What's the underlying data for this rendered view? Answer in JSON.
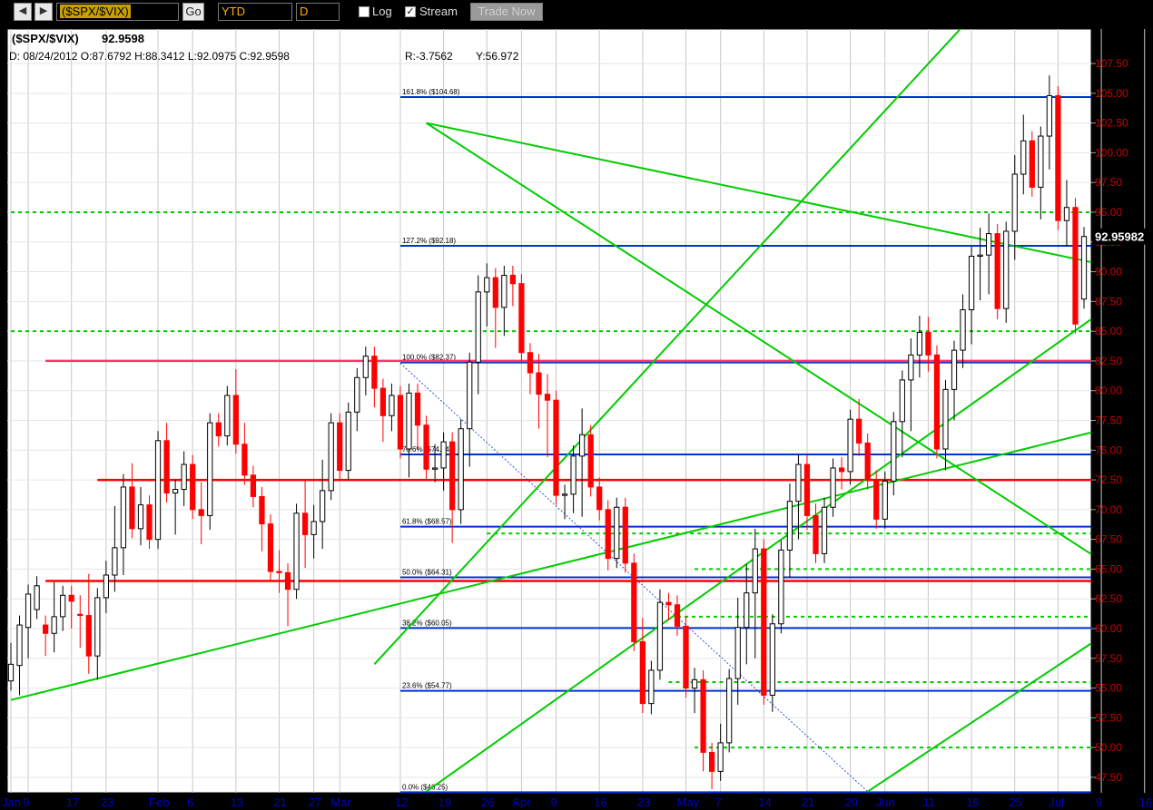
{
  "toolbar": {
    "back_icon": "chevron-left-icon",
    "forward_icon": "chevron-right-icon",
    "symbol_value": "($SPX/$VIX)",
    "go_label": "Go",
    "range_value": "YTD",
    "period_value": "D",
    "log_label": "Log",
    "log_checked": false,
    "stream_label": "Stream",
    "stream_checked": true,
    "trade_label": "Trade Now"
  },
  "header": {
    "title": "($SPX/$VIX)",
    "last": "92.9598",
    "ohlc": "D: 08/24/2012 O:87.6792 H:88.3412 L:92.0975 C:92.9598",
    "range_text": "R:-3.7562",
    "y_text": "Y:56.972"
  },
  "colors": {
    "background": "#ffffff",
    "frame": "#000000",
    "up_candle": "#000000",
    "down_candle": "#ff0000",
    "fib_line": "#0033cc",
    "trend_line": "#00cc00",
    "horizontal_red": "#ff0000",
    "horizontal_pink": "#ff3366",
    "cyan_line": "#00bbee",
    "axis_text": "#cc0000",
    "date_text": "#0000cc"
  },
  "chart_data": {
    "type": "candlestick",
    "title": "($SPX/$VIX)",
    "ylim": [
      46.2,
      110.4
    ],
    "y_ticks": [
      47.5,
      50,
      52.5,
      55,
      57.5,
      60,
      62.5,
      65,
      67.5,
      70,
      72.5,
      75,
      77.5,
      80,
      82.5,
      85,
      87.5,
      90,
      92.5,
      95,
      97.5,
      100,
      102.5,
      105,
      107.5
    ],
    "last_value_label": "92.95982",
    "x_labels": [
      {
        "label": "Jan",
        "i": 0
      },
      {
        "label": "9",
        "i": 2
      },
      {
        "label": "17",
        "i": 7
      },
      {
        "label": "23",
        "i": 11
      },
      {
        "label": "Feb",
        "i": 17
      },
      {
        "label": "6",
        "i": 21
      },
      {
        "label": "13",
        "i": 26
      },
      {
        "label": "21",
        "i": 31
      },
      {
        "label": "27",
        "i": 35
      },
      {
        "label": "Mar",
        "i": 38
      },
      {
        "label": "12",
        "i": 45
      },
      {
        "label": "19",
        "i": 50
      },
      {
        "label": "26",
        "i": 55
      },
      {
        "label": "Apr",
        "i": 59
      },
      {
        "label": "9",
        "i": 63
      },
      {
        "label": "16",
        "i": 68
      },
      {
        "label": "23",
        "i": 73
      },
      {
        "label": "May",
        "i": 78
      },
      {
        "label": "7",
        "i": 82
      },
      {
        "label": "14",
        "i": 87
      },
      {
        "label": "21",
        "i": 92
      },
      {
        "label": "29",
        "i": 97
      },
      {
        "label": "Jun",
        "i": 101
      },
      {
        "label": "11",
        "i": 106
      },
      {
        "label": "18",
        "i": 111
      },
      {
        "label": "25",
        "i": 116
      },
      {
        "label": "Jul",
        "i": 121
      },
      {
        "label": "9",
        "i": 126
      },
      {
        "label": "16",
        "i": 131
      },
      {
        "label": "23",
        "i": 136
      },
      {
        "label": "Aug",
        "i": 142
      },
      {
        "label": "6",
        "i": 146
      },
      {
        "label": "13",
        "i": 151
      },
      {
        "label": "20",
        "i": 156
      }
    ],
    "candles": [
      [
        55.6,
        58.0,
        55.6,
        57.0
      ],
      [
        56.9,
        59.1,
        55.2,
        60.3
      ],
      [
        60.1,
        62.9,
        58.3,
        62.9
      ],
      [
        61.6,
        63.6,
        61.6,
        63.6
      ],
      [
        60.3,
        60.3,
        58.5,
        59.6
      ],
      [
        59.6,
        63.1,
        58.8,
        61.0
      ],
      [
        61.0,
        62.5,
        60.6,
        62.8
      ],
      [
        62.8,
        62.6,
        60.8,
        62.3
      ],
      [
        61.2,
        62.0,
        59.2,
        61.1
      ],
      [
        61.1,
        63.8,
        57.0,
        57.7
      ],
      [
        57.7,
        62.2,
        56.5,
        62.6
      ],
      [
        62.6,
        64.9,
        62.1,
        64.5
      ],
      [
        64.5,
        69.5,
        63.9,
        66.8
      ],
      [
        66.8,
        72.2,
        65.3,
        71.9
      ],
      [
        71.9,
        73.1,
        70.0,
        68.4
      ],
      [
        68.4,
        71.1,
        67.8,
        70.4
      ],
      [
        70.4,
        68.1,
        67.7,
        67.5
      ],
      [
        67.5,
        73.6,
        67.6,
        75.8
      ],
      [
        75.8,
        76.5,
        73.6,
        71.4
      ],
      [
        71.4,
        69.1,
        68.7,
        71.7
      ],
      [
        71.7,
        74.1,
        71.1,
        73.8
      ],
      [
        73.8,
        71.1,
        70.6,
        70.0
      ],
      [
        70.0,
        71.5,
        67.9,
        69.5
      ],
      [
        69.5,
        77.1,
        69.1,
        77.3
      ],
      [
        77.3,
        77.2,
        76.1,
        76.2
      ],
      [
        76.2,
        77.8,
        76.4,
        79.6
      ],
      [
        79.6,
        81.0,
        75.8,
        75.5
      ],
      [
        75.5,
        76.5,
        73.7,
        72.9
      ],
      [
        72.9,
        71.4,
        71.0,
        71.1
      ],
      [
        71.1,
        69.7,
        67.3,
        68.8
      ],
      [
        68.8,
        67.8,
        65.2,
        64.8
      ],
      [
        64.8,
        65.8,
        63.8,
        64.7
      ],
      [
        64.7,
        63.4,
        61.0,
        63.3
      ],
      [
        63.3,
        67.8,
        63.4,
        69.7
      ],
      [
        69.7,
        71.7,
        65.9,
        67.9
      ],
      [
        67.9,
        69.6,
        66.7,
        69.0
      ],
      [
        69.0,
        73.4,
        67.5,
        71.6
      ],
      [
        71.6,
        75.1,
        72.0,
        77.3
      ],
      [
        77.3,
        74.4,
        73.8,
        73.3
      ],
      [
        73.3,
        77.3,
        73.9,
        78.2
      ],
      [
        78.2,
        79.9,
        77.4,
        81.1
      ],
      [
        81.1,
        82.4,
        80.4,
        82.9
      ],
      [
        82.9,
        81.5,
        79.4,
        80.2
      ],
      [
        80.2,
        78.5,
        76.5,
        77.9
      ],
      [
        77.9,
        79.8,
        77.4,
        79.6
      ],
      [
        79.6,
        77.0,
        76.1,
        75.1
      ],
      [
        75.1,
        78.3,
        73.5,
        79.8
      ],
      [
        79.8,
        76.9,
        75.9,
        77.1
      ],
      [
        77.1,
        73.6,
        73.2,
        73.4
      ],
      [
        73.4,
        74.7,
        73.1,
        73.5
      ],
      [
        73.5,
        74.1,
        72.4,
        75.7
      ],
      [
        75.7,
        70.8,
        68.0,
        70.0
      ],
      [
        70.0,
        75.4,
        69.6,
        76.8
      ],
      [
        76.8,
        79.5,
        74.4,
        82.4
      ],
      [
        82.4,
        88.9,
        80.5,
        88.3
      ],
      [
        88.3,
        89.9,
        86.2,
        89.5
      ],
      [
        89.5,
        87.6,
        84.4,
        87.0
      ],
      [
        87.0,
        88.3,
        85.4,
        89.7
      ],
      [
        89.7,
        89.3,
        87.9,
        89.0
      ],
      [
        89.0,
        88.3,
        84.6,
        83.2
      ],
      [
        83.2,
        81.7,
        80.5,
        81.5
      ],
      [
        81.5,
        82.3,
        77.6,
        79.7
      ],
      [
        79.7,
        80.6,
        75.2,
        79.2
      ],
      [
        79.2,
        75.1,
        72.1,
        71.2
      ],
      [
        71.2,
        71.2,
        70.0,
        71.3
      ],
      [
        71.3,
        74.6,
        70.5,
        74.5
      ],
      [
        74.5,
        77.7,
        70.2,
        76.3
      ],
      [
        76.3,
        76.1,
        72.7,
        71.9
      ],
      [
        71.9,
        70.7,
        69.9,
        70.0
      ],
      [
        70.0,
        67.6,
        65.7,
        65.9
      ],
      [
        65.9,
        68.2,
        67.1,
        70.2
      ],
      [
        70.2,
        67.5,
        66.4,
        65.5
      ],
      [
        65.5,
        61.5,
        59.1,
        58.9
      ],
      [
        58.9,
        60.1,
        53.7,
        53.7
      ],
      [
        53.7,
        56.0,
        53.6,
        56.5
      ],
      [
        56.5,
        62.5,
        58.0,
        62.2
      ],
      [
        62.2,
        61.9,
        61.5,
        62.0
      ],
      [
        62.0,
        61.0,
        60.2,
        60.2
      ],
      [
        60.2,
        55.9,
        55.4,
        55.0
      ],
      [
        55.0,
        55.9,
        53.7,
        55.7
      ],
      [
        55.7,
        52.4,
        48.8,
        49.6
      ],
      [
        49.6,
        49.2,
        47.3,
        48.0
      ],
      [
        48.0,
        51.2,
        48.4,
        50.4
      ],
      [
        50.4,
        53.3,
        51.4,
        55.8
      ],
      [
        55.8,
        61.8,
        54.4,
        60.1
      ],
      [
        60.1,
        64.6,
        57.8,
        63.0
      ],
      [
        63.0,
        67.6,
        58.3,
        66.7
      ],
      [
        66.7,
        57.8,
        55.5,
        54.4
      ],
      [
        54.4,
        60.3,
        53.8,
        60.4
      ],
      [
        60.4,
        66.4,
        61.3,
        66.6
      ],
      [
        66.6,
        71.4,
        65.1,
        70.7
      ],
      [
        70.7,
        73.1,
        68.3,
        73.8
      ],
      [
        73.8,
        71.5,
        69.1,
        69.5
      ],
      [
        69.5,
        69.7,
        67.4,
        66.3
      ],
      [
        66.3,
        68.9,
        67.6,
        70.2
      ],
      [
        70.2,
        72.5,
        71.4,
        73.5
      ],
      [
        73.5,
        73.6,
        72.5,
        73.2
      ],
      [
        73.2,
        76.2,
        72.9,
        77.6
      ],
      [
        77.6,
        78.5,
        75.3,
        75.6
      ],
      [
        75.6,
        73.9,
        73.3,
        72.5
      ],
      [
        72.5,
        69.7,
        69.5,
        69.2
      ],
      [
        69.2,
        71.5,
        69.8,
        72.4
      ],
      [
        72.4,
        75.3,
        72.0,
        77.4
      ],
      [
        77.4,
        80.3,
        75.2,
        80.9
      ],
      [
        80.9,
        83.6,
        77.4,
        83.0
      ],
      [
        83.0,
        85.5,
        81.9,
        84.9
      ],
      [
        84.9,
        85.4,
        82.4,
        83.0
      ],
      [
        83.0,
        80.8,
        76.1,
        75.1
      ],
      [
        75.1,
        79.4,
        74.1,
        80.1
      ],
      [
        80.1,
        82.9,
        78.3,
        83.4
      ],
      [
        83.4,
        87.3,
        82.7,
        86.8
      ],
      [
        86.8,
        91.2,
        84.7,
        91.3
      ],
      [
        91.3,
        92.9,
        88.4,
        91.4
      ],
      [
        91.4,
        94.1,
        88.9,
        93.2
      ],
      [
        93.2,
        89.2,
        86.8,
        86.9
      ],
      [
        86.9,
        93.4,
        86.5,
        93.4
      ],
      [
        93.4,
        99.0,
        91.8,
        98.2
      ],
      [
        98.2,
        102.4,
        97.3,
        101.0
      ],
      [
        101.0,
        100.3,
        97.4,
        97.1
      ],
      [
        97.1,
        100.6,
        95.2,
        101.4
      ],
      [
        101.4,
        105.7,
        99.4,
        104.8
      ],
      [
        104.8,
        104.1,
        94.7,
        94.3
      ],
      [
        94.3,
        96.9,
        92.9,
        95.4
      ],
      [
        95.4,
        94.5,
        86.3,
        85.6
      ],
      [
        87.7,
        88.3,
        92.1,
        92.96
      ]
    ],
    "fib_levels": [
      {
        "label": "161.8% ($104.68)",
        "value": 104.68,
        "from": 45
      },
      {
        "label": "127.2% ($92.18)",
        "value": 92.18,
        "from": 45
      },
      {
        "label": "100.0% ($82.37)",
        "value": 82.37,
        "from": 45
      },
      {
        "label": "78.6% ($74.64)",
        "value": 74.64,
        "from": 45
      },
      {
        "label": "61.8% ($68.57)",
        "value": 68.57,
        "from": 45
      },
      {
        "label": "50.0% ($64.31)",
        "value": 64.31,
        "from": 45
      },
      {
        "label": "38.2% ($60.05)",
        "value": 60.05,
        "from": 45
      },
      {
        "label": "23.6% ($54.77)",
        "value": 54.77,
        "from": 45
      },
      {
        "label": "0.0% ($46.25)",
        "value": 46.25,
        "from": 45
      }
    ],
    "dashed_levels": [
      {
        "value": 95.0,
        "from": 0
      },
      {
        "value": 85.0,
        "from": 0
      },
      {
        "value": 68.0,
        "from": 55
      },
      {
        "value": 65.0,
        "from": 79
      },
      {
        "value": 61.0,
        "from": 77
      },
      {
        "value": 55.5,
        "from": 76
      },
      {
        "value": 50.0,
        "from": 79
      }
    ],
    "horizontal_levels": [
      {
        "value": 82.5,
        "from": 4,
        "color": "pink"
      },
      {
        "value": 72.5,
        "from": 10,
        "color": "red"
      },
      {
        "value": 64.0,
        "from": 4,
        "color": "red"
      }
    ],
    "trend_lines": [
      {
        "i1": 0,
        "v1": 54.0,
        "i2": 161,
        "v2": 83.0
      },
      {
        "i1": 48,
        "v1": 102.5,
        "i2": 161,
        "v2": 85.3
      },
      {
        "i1": 48,
        "v1": 102.5,
        "i2": 161,
        "v2": 49.2
      },
      {
        "i1": 42,
        "v1": 57.0,
        "i2": 113,
        "v2": 113.0
      },
      {
        "i1": 48,
        "v1": 46.3,
        "i2": 161,
        "v2": 104.7
      },
      {
        "i1": 99,
        "v1": 46.3,
        "i2": 161,
        "v2": 76.2
      }
    ],
    "thin_lines": [
      {
        "i1": 45,
        "v1": 82.3,
        "i2": 99,
        "v2": 46.3
      }
    ],
    "cyan_lines": [
      {
        "i1": 133,
        "v1": 65.0,
        "i2": 161,
        "v2": 85.6
      }
    ]
  }
}
